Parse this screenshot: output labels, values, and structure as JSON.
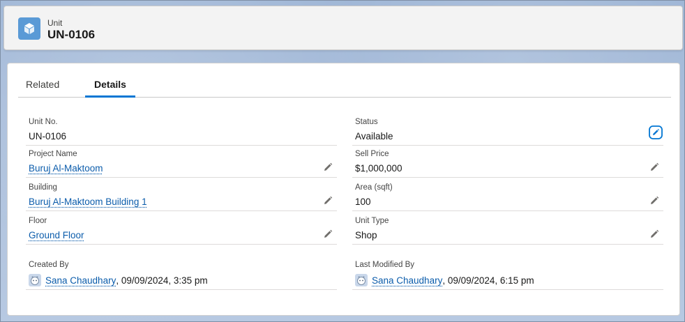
{
  "header": {
    "object_type": "Unit",
    "record_name": "UN-0106",
    "icon": "cube-icon",
    "icon_color": "#5a9ad6"
  },
  "tabs": [
    {
      "label": "Related",
      "active": false
    },
    {
      "label": "Details",
      "active": true
    }
  ],
  "fields": {
    "unit_no": {
      "label": "Unit No.",
      "value": "UN-0106"
    },
    "status": {
      "label": "Status",
      "value": "Available"
    },
    "project_name": {
      "label": "Project Name",
      "value": "Buruj Al-Maktoom"
    },
    "sell_price": {
      "label": "Sell Price",
      "value": "$1,000,000"
    },
    "building": {
      "label": "Building",
      "value": "Buruj Al-Maktoom Building 1"
    },
    "area": {
      "label": "Area (sqft)",
      "value": "100"
    },
    "floor": {
      "label": "Floor",
      "value": "Ground Floor"
    },
    "unit_type": {
      "label": "Unit Type",
      "value": "Shop"
    }
  },
  "audit": {
    "created_by": {
      "label": "Created By",
      "user": "Sana Chaudhary",
      "timestamp": ", 09/09/2024, 3:35 pm"
    },
    "last_modified_by": {
      "label": "Last Modified By",
      "user": "Sana Chaudhary",
      "timestamp": ", 09/09/2024, 6:15 pm"
    }
  },
  "colors": {
    "link": "#0b5cab",
    "active_tab": "#0176d3"
  }
}
